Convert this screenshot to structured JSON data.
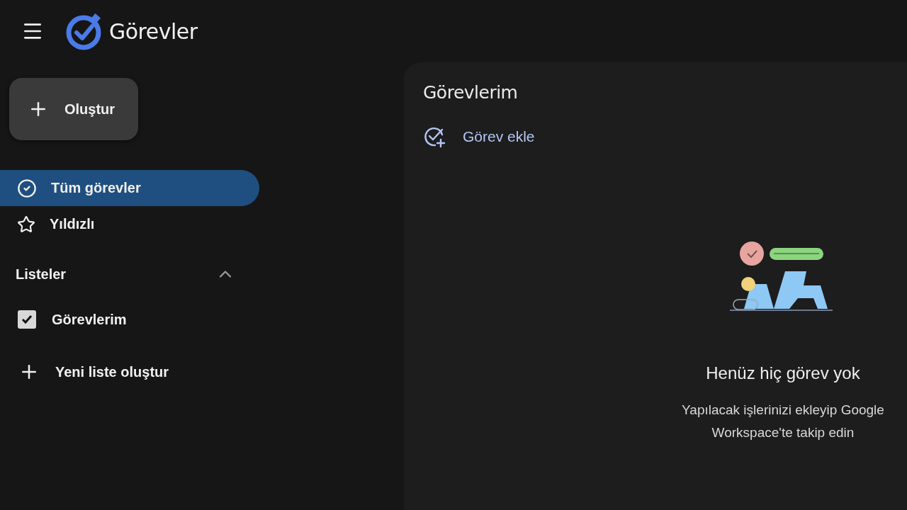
{
  "app": {
    "title": "Görevler"
  },
  "create_button": {
    "label": "Oluştur"
  },
  "nav": [
    {
      "label": "Tüm görevler",
      "kind": "all",
      "selected": true
    },
    {
      "label": "Yıldızlı",
      "kind": "starred",
      "selected": false
    }
  ],
  "lists_section": {
    "title": "Listeler",
    "expanded": true,
    "lists": [
      {
        "label": "Görevlerim",
        "checked": true
      }
    ],
    "new_list": "Yeni liste oluştur"
  },
  "main": {
    "title": "Görevlerim",
    "add_task": "Görev ekle",
    "empty_state": {
      "title": "Henüz hiç görev yok",
      "message": "Yapılacak işlerinizi ekleyip Google Workspace'te takip edin"
    }
  }
}
